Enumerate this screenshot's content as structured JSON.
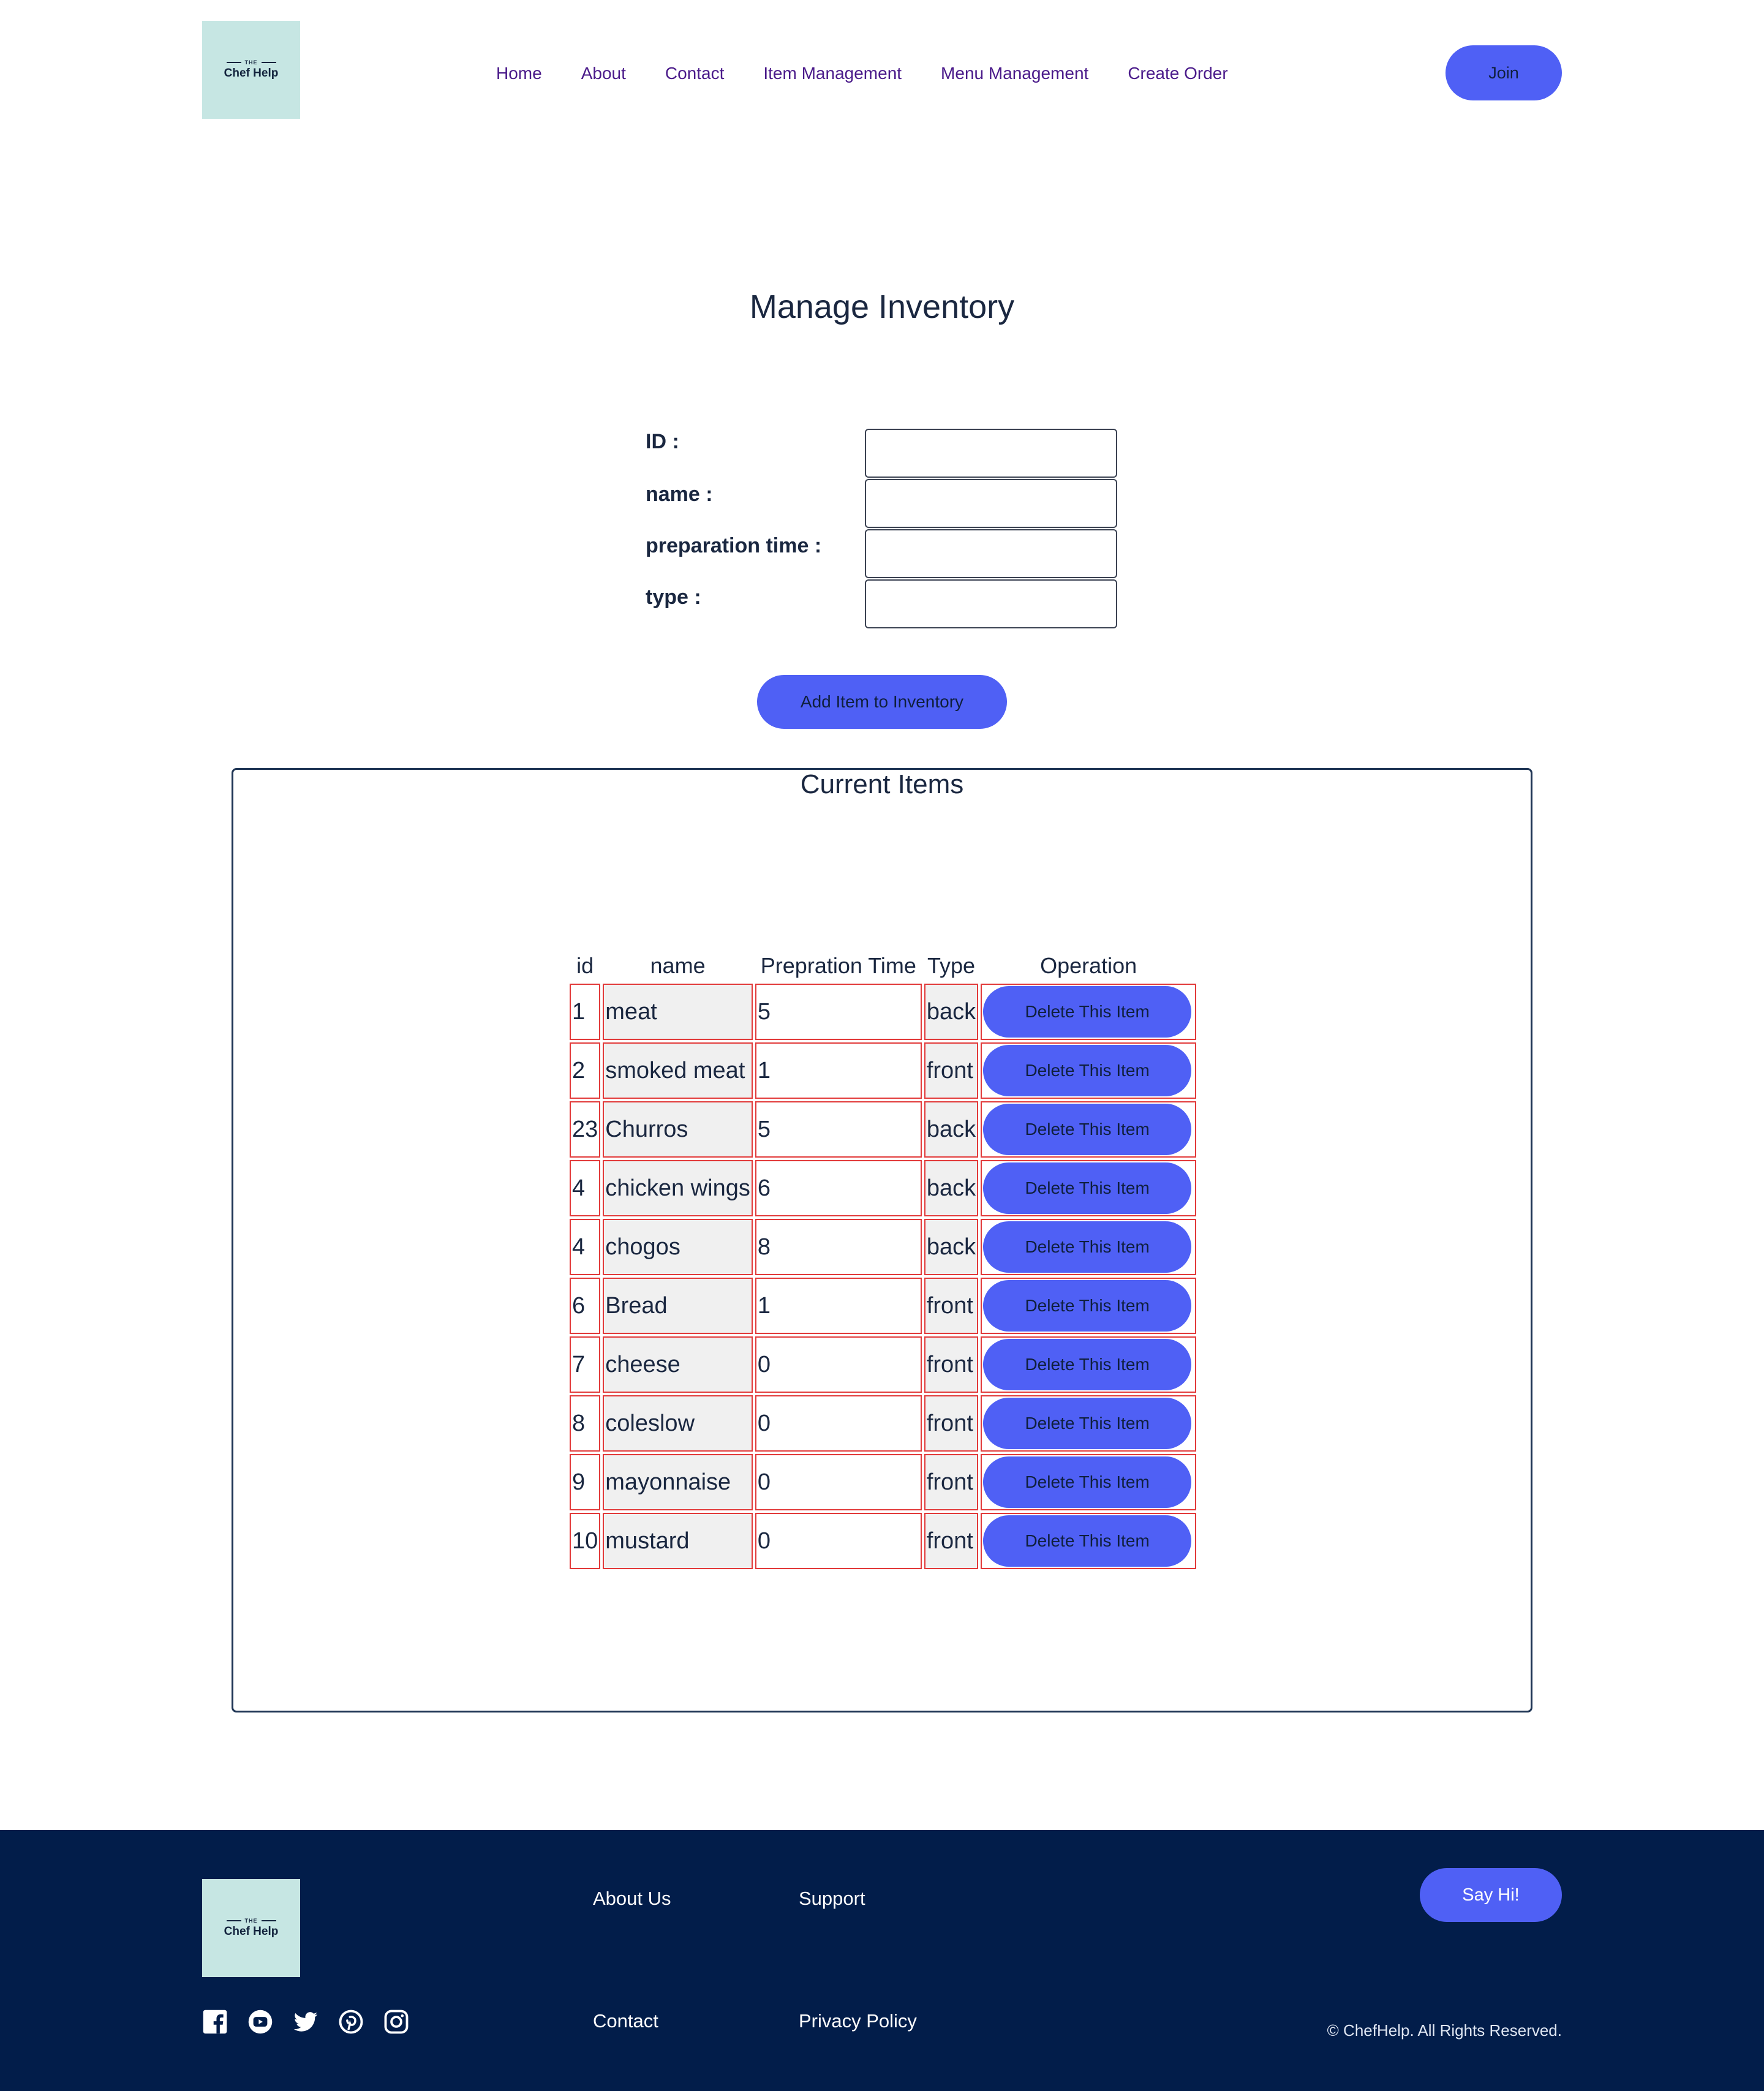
{
  "header": {
    "logo_the": "THE",
    "logo_name": "Chef Help",
    "nav": [
      "Home",
      "About",
      "Contact",
      "Item Management",
      "Menu Management",
      "Create Order"
    ],
    "join_label": "Join"
  },
  "main": {
    "title": "Manage Inventory",
    "form": {
      "id_label": "ID :",
      "name_label": "name :",
      "prep_label": "preparation time :",
      "type_label": "type :",
      "id_value": "",
      "name_value": "",
      "prep_value": "",
      "type_value": ""
    },
    "add_button": "Add Item to Inventory",
    "panel_title": "Current Items",
    "table": {
      "headers": [
        "id",
        "name",
        "Prepration Time",
        "Type",
        "Operation"
      ],
      "rows": [
        {
          "id": "1",
          "name": "meat",
          "prep": "5",
          "type": "back",
          "op": "Delete This Item"
        },
        {
          "id": "2",
          "name": "smoked meat",
          "prep": "1",
          "type": "front",
          "op": "Delete This Item"
        },
        {
          "id": "23",
          "name": "Churros",
          "prep": "5",
          "type": "back",
          "op": "Delete This Item"
        },
        {
          "id": "4",
          "name": "chicken wings",
          "prep": "6",
          "type": "back",
          "op": "Delete This Item"
        },
        {
          "id": "4",
          "name": "chogos",
          "prep": "8",
          "type": "back",
          "op": "Delete This Item"
        },
        {
          "id": "6",
          "name": "Bread",
          "prep": "1",
          "type": "front",
          "op": "Delete This Item"
        },
        {
          "id": "7",
          "name": "cheese",
          "prep": "0",
          "type": "front",
          "op": "Delete This Item"
        },
        {
          "id": "8",
          "name": "coleslow",
          "prep": "0",
          "type": "front",
          "op": "Delete This Item"
        },
        {
          "id": "9",
          "name": "mayonnaise",
          "prep": "0",
          "type": "front",
          "op": "Delete This Item"
        },
        {
          "id": "10",
          "name": "mustard",
          "prep": "0",
          "type": "front",
          "op": "Delete This Item"
        }
      ]
    }
  },
  "footer": {
    "logo_the": "THE",
    "logo_name": "Chef Help",
    "links": [
      "About Us",
      "Support",
      "Contact",
      "Privacy Policy"
    ],
    "say_hi": "Say Hi!",
    "copyright": "© ChefHelp. All Rights Reserved.",
    "social_icons": [
      "facebook-icon",
      "youtube-icon",
      "twitter-icon",
      "pinterest-icon",
      "instagram-icon"
    ]
  },
  "colors": {
    "accent": "#4f60f5",
    "nav_text": "#4a1a8a",
    "footer_bg": "#021d4a",
    "logo_bg": "#c6e6e3",
    "table_border": "#e23a3a"
  }
}
